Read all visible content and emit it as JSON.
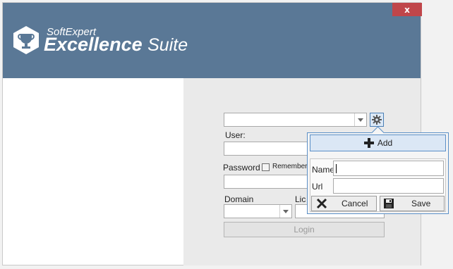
{
  "window": {
    "close_label": "x",
    "colors": {
      "header": "#5a7896",
      "close": "#c0464a",
      "accent": "#5b8fc7"
    }
  },
  "brand": {
    "top_text": "SoftExpert",
    "main_bold": "Excellence",
    "main_light": "Suite",
    "logo_icon": "trophy-icon"
  },
  "login": {
    "server_select_value": "",
    "gear_icon": "gear-icon",
    "user_label": "User:",
    "user_value": "",
    "password_label": "Password",
    "remember_label": "Remember me",
    "password_value": "",
    "domain_label": "Domain",
    "domain_value": "",
    "license_label": "License",
    "license_value": "",
    "login_button": "Login"
  },
  "server_popup": {
    "add_label": "Add",
    "add_icon": "plus-icon",
    "name_label": "Name",
    "name_value": "",
    "url_label": "Url",
    "url_value": "",
    "cancel_label": "Cancel",
    "cancel_icon": "x-icon",
    "save_label": "Save",
    "save_icon": "floppy-disk-icon"
  }
}
